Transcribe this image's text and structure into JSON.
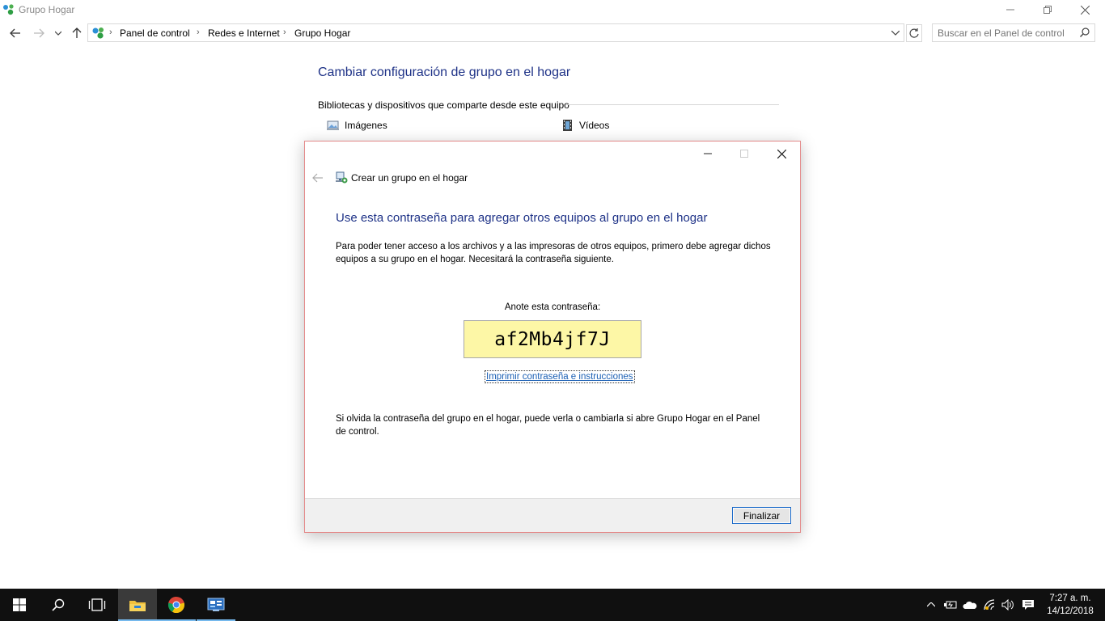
{
  "window": {
    "title": "Grupo Hogar"
  },
  "navbar": {
    "breadcrumbs": [
      "Panel de control",
      "Redes e Internet",
      "Grupo Hogar"
    ],
    "search_placeholder": "Buscar en el Panel de control"
  },
  "background": {
    "heading": "Cambiar configuración de grupo en el hogar",
    "section_label": "Bibliotecas y dispositivos que comparte desde este equipo",
    "items": [
      {
        "label": "Imágenes",
        "icon": "pictures-icon"
      },
      {
        "label": "Vídeos",
        "icon": "videos-icon"
      }
    ]
  },
  "dialog": {
    "title": "Crear un grupo en el hogar",
    "heading": "Use esta contraseña para agregar otros equipos al grupo en el hogar",
    "paragraph1": "Para poder tener acceso a los archivos y a las impresoras de otros equipos, primero debe agregar dichos equipos a su grupo en el hogar. Necesitará la contraseña siguiente.",
    "password_label": "Anote esta contraseña:",
    "password": "af2Mb4jf7J",
    "print_link": "Imprimir contraseña e instrucciones",
    "paragraph2": "Si olvida la contraseña del grupo en el hogar, puede verla o cambiarla si abre Grupo Hogar en el Panel de control.",
    "finish_label": "Finalizar"
  },
  "taskbar": {
    "apps": [
      "start-icon",
      "search-icon",
      "task-view-icon",
      "file-explorer-icon",
      "chrome-icon",
      "control-panel-icon"
    ],
    "time": "7:27 a. m.",
    "date": "14/12/2018"
  },
  "colors": {
    "heading_blue": "#1e3287",
    "password_bg": "#fdf7a6",
    "link_blue": "#1a5fb4",
    "taskbar_bg": "#101010"
  }
}
